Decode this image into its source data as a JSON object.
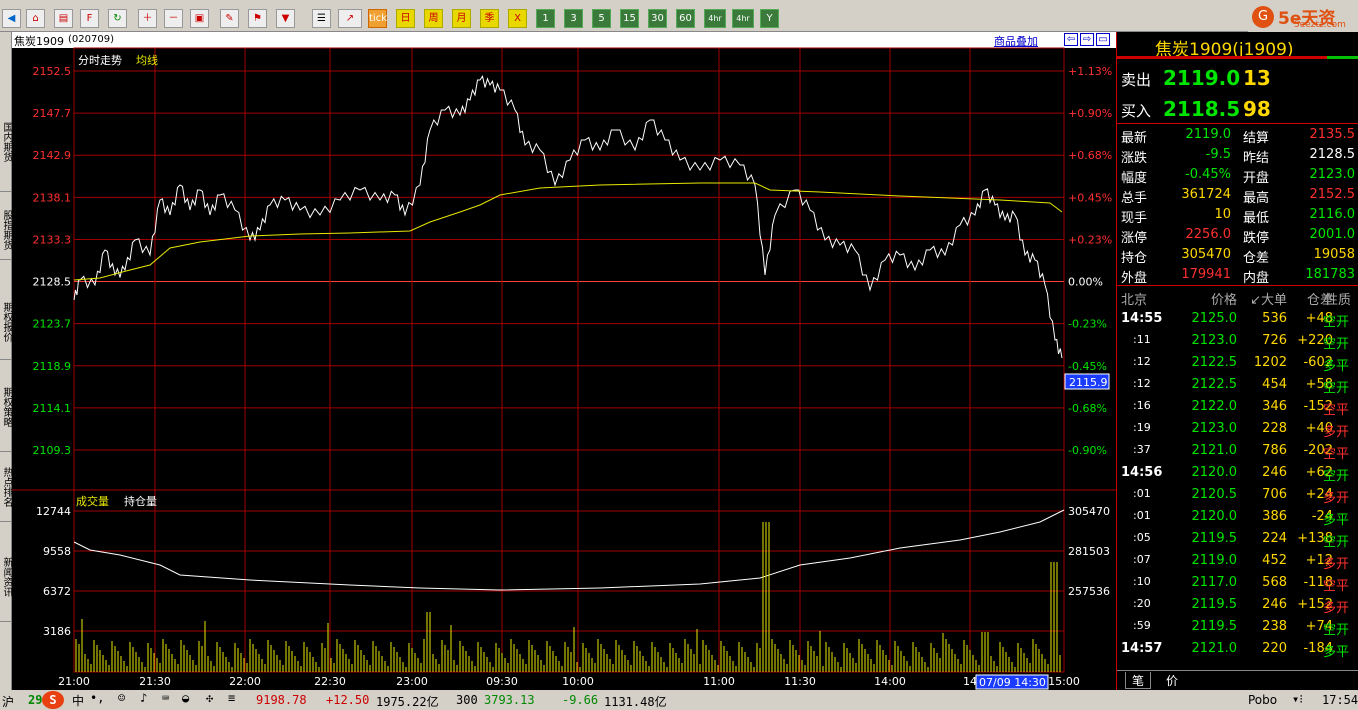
{
  "toolbar": {
    "buttons": [
      "tick",
      "日",
      "周",
      "月",
      "季",
      "X",
      "1",
      "3",
      "5",
      "15",
      "30",
      "60",
      "4hr",
      "Y"
    ]
  },
  "brand": {
    "name": "5e天资",
    "sub": "5eeztz.com"
  },
  "sidebar": [
    "国内期货",
    "股指期货",
    "期权报价",
    "期权策略",
    "热点排名",
    "新闻资讯"
  ],
  "chart": {
    "symbol": "焦炭1909",
    "code": "(020709)",
    "overlay_label": "商品叠加",
    "legend_price": "分时走势",
    "legend_avg": "均线",
    "legend_vol": "成交量",
    "legend_oi": "持仓量",
    "y_prices": [
      "2152.5",
      "2147.7",
      "2142.9",
      "2138.1",
      "2133.3",
      "2128.5",
      "2123.7",
      "2118.9",
      "2114.1",
      "2109.3"
    ],
    "y_pcts": [
      "+1.13%",
      "+0.90%",
      "+0.68%",
      "+0.45%",
      "+0.23%",
      "0.00%",
      "-0.23%",
      "-0.45%",
      "-0.68%",
      "-0.90%"
    ],
    "cursor_price": "2115.9",
    "vol_axis": [
      "12744",
      "9558",
      "6372",
      "3186"
    ],
    "oi_axis": [
      "305470",
      "281503",
      "257536"
    ],
    "x_labels": [
      "21:00",
      "21:30",
      "22:00",
      "22:30",
      "23:00",
      "09:30",
      "10:00",
      "11:00",
      "11:30",
      "14:00",
      "14",
      "15:00"
    ],
    "cursor_time": "07/09 14:30",
    "colors": {
      "up": "#ff3030",
      "down": "#00e600",
      "grid": "#a00000",
      "avg": "#e8e800",
      "price": "#ffffff"
    }
  },
  "quote": {
    "title": "焦炭1909(j1909)",
    "ask_label": "卖出",
    "ask": "2119.0",
    "ask_vol": "13",
    "bid_label": "买入",
    "bid": "2118.5",
    "bid_vol": "98",
    "stats": [
      [
        "最新",
        "2119.0",
        "结算",
        "2135.5"
      ],
      [
        "涨跌",
        "-9.5",
        "昨结",
        "2128.5"
      ],
      [
        "幅度",
        "-0.45%",
        "开盘",
        "2123.0"
      ],
      [
        "总手",
        "361724",
        "最高",
        "2152.5"
      ],
      [
        "现手",
        "10",
        "最低",
        "2116.0"
      ],
      [
        "涨停",
        "2256.0",
        "跌停",
        "2001.0"
      ],
      [
        "持仓",
        "305470",
        "仓差",
        "19058"
      ],
      [
        "外盘",
        "179941",
        "内盘",
        "181783"
      ]
    ],
    "tick_header": [
      "北京",
      "价格",
      "↙大单",
      "仓差",
      "性质"
    ],
    "ticks": [
      [
        "14:55",
        "2125.0",
        "536",
        "+48",
        "空开"
      ],
      [
        ":11",
        "2123.0",
        "726",
        "+220",
        "空开"
      ],
      [
        ":12",
        "2122.5",
        "1202",
        "-602",
        "多平"
      ],
      [
        ":12",
        "2122.5",
        "454",
        "+58",
        "空开"
      ],
      [
        ":16",
        "2122.0",
        "346",
        "-152",
        "空平"
      ],
      [
        ":19",
        "2123.0",
        "228",
        "+40",
        "多开"
      ],
      [
        ":37",
        "2121.0",
        "786",
        "-202",
        "空平"
      ],
      [
        "14:56",
        "2120.0",
        "246",
        "+62",
        "空开"
      ],
      [
        ":01",
        "2120.5",
        "706",
        "+24",
        "多开"
      ],
      [
        ":01",
        "2120.0",
        "386",
        "-24",
        "多平"
      ],
      [
        ":05",
        "2119.5",
        "224",
        "+138",
        "空开"
      ],
      [
        ":07",
        "2119.0",
        "452",
        "+12",
        "多开"
      ],
      [
        ":10",
        "2117.0",
        "568",
        "-118",
        "空平"
      ],
      [
        ":20",
        "2119.5",
        "246",
        "+152",
        "多开"
      ],
      [
        ":59",
        "2119.5",
        "238",
        "+74",
        "空开"
      ],
      [
        "14:57",
        "2121.0",
        "220",
        "-184",
        "多平"
      ]
    ],
    "tabs": [
      "笔",
      "价"
    ]
  },
  "statusbar": {
    "s1_name": "沪",
    "s1_val": "29",
    "idx_val": "9198.78",
    "idx_chg": "+12.50",
    "idx_amt": "1975.22亿",
    "i300_name": "300",
    "i300_val": "3793.13",
    "i300_chg": "-9.66",
    "i300_amt": "1131.48亿",
    "pobo": "Pobo",
    "time": "17:54"
  }
}
